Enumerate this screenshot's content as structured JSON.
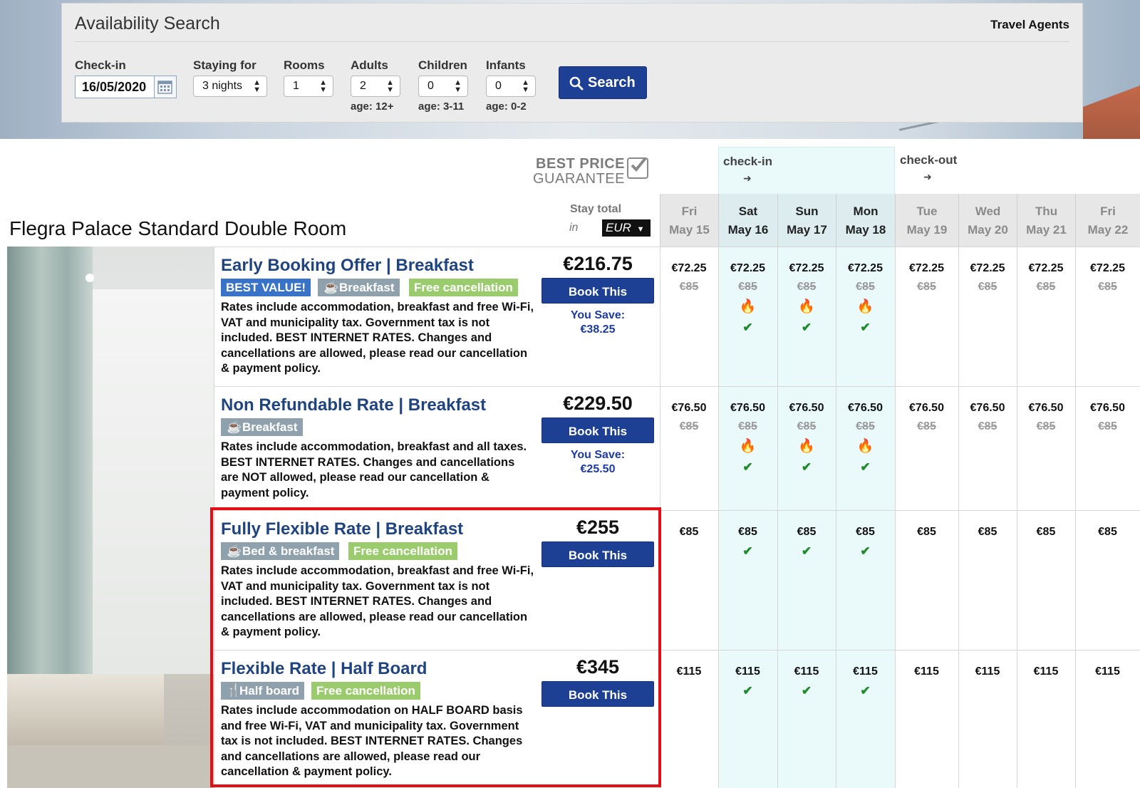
{
  "search": {
    "title": "Availability Search",
    "agents_link": "Travel Agents",
    "checkin_label": "Check-in",
    "checkin_value": "16/05/2020",
    "staying_label": "Staying for",
    "staying_value": "3 nights",
    "rooms_label": "Rooms",
    "rooms_value": "1",
    "adults_label": "Adults",
    "adults_value": "2",
    "adults_age": "age: 12+",
    "children_label": "Children",
    "children_value": "0",
    "children_age": "age: 3-11",
    "infants_label": "Infants",
    "infants_value": "0",
    "infants_age": "age: 0-2",
    "search_button": "Search"
  },
  "header": {
    "best_price_line1": "BEST PRICE",
    "best_price_line2": "GUARANTEE",
    "room_title": "Flegra Palace Standard Double Room",
    "stay_total": "Stay total",
    "stay_in": "in",
    "currency": "EUR",
    "checkin_label": "check-in",
    "checkout_label": "check-out"
  },
  "days": [
    {
      "dow": "Fri",
      "date": "May 15"
    },
    {
      "dow": "Sat",
      "date": "May 16"
    },
    {
      "dow": "Sun",
      "date": "May 17"
    },
    {
      "dow": "Mon",
      "date": "May 18"
    },
    {
      "dow": "Tue",
      "date": "May 19"
    },
    {
      "dow": "Wed",
      "date": "May 20"
    },
    {
      "dow": "Thu",
      "date": "May 21"
    },
    {
      "dow": "Fri",
      "date": "May 22"
    }
  ],
  "rates": [
    {
      "title": "Early Booking Offer | Breakfast",
      "tags": [
        "BEST VALUE!",
        "Breakfast",
        "Free cancellation"
      ],
      "desc": "Rates include accommodation, breakfast and free Wi-Fi, VAT and municipality tax. Government tax is not included. BEST INTERNET RATES. Changes and cancellations are allowed, please read our cancellation & payment policy.",
      "price": "€216.75",
      "book": "Book This",
      "save_label": "You Save:",
      "save_value": "€38.25",
      "nightly": [
        "€72.25",
        "€72.25",
        "€72.25",
        "€72.25",
        "€72.25",
        "€72.25",
        "€72.25",
        "€72.25"
      ],
      "old_price": "€85"
    },
    {
      "title": "Non Refundable Rate | Breakfast",
      "tags": [
        "Breakfast"
      ],
      "desc": "Rates include accommodation, breakfast and all taxes. BEST INTERNET RATES. Changes and cancellations are NOT allowed, please read our cancellation & payment policy.",
      "price": "€229.50",
      "book": "Book This",
      "save_label": "You Save:",
      "save_value": "€25.50",
      "nightly": [
        "€76.50",
        "€76.50",
        "€76.50",
        "€76.50",
        "€76.50",
        "€76.50",
        "€76.50",
        "€76.50"
      ],
      "old_price": "€85"
    },
    {
      "title": "Fully Flexible Rate | Breakfast",
      "tags": [
        "Bed & breakfast",
        "Free cancellation"
      ],
      "desc": "Rates include accommodation, breakfast and free Wi-Fi, VAT and municipality tax. Government tax is not included. BEST INTERNET RATES. Changes and cancellations are allowed, please read our cancellation & payment policy.",
      "price": "€255",
      "book": "Book This",
      "nightly": [
        "€85",
        "€85",
        "€85",
        "€85",
        "€85",
        "€85",
        "€85",
        "€85"
      ]
    },
    {
      "title": "Flexible Rate | Half Board",
      "tags": [
        "Half board",
        "Free cancellation"
      ],
      "desc": "Rates include accommodation on HALF BOARD basis and free Wi-Fi, VAT and municipality tax. Government tax is not included. BEST INTERNET RATES. Changes and cancellations are allowed, please read our cancellation & payment policy.",
      "price": "€345",
      "book": "Book This",
      "nightly": [
        "€115",
        "€115",
        "€115",
        "€115",
        "€115",
        "€115",
        "€115",
        "€115"
      ]
    }
  ],
  "icons": {
    "fire": "fire-icon",
    "check": "check-icon",
    "calendar": "calendar-icon",
    "search": "search-icon"
  },
  "colors": {
    "brand_blue": "#1d3f94",
    "title_blue": "#1f4480",
    "highlight": "#e20f16",
    "stay_band": "#eafafb"
  }
}
